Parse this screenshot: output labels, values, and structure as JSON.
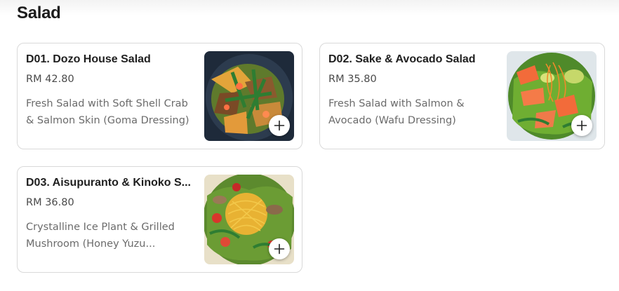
{
  "section": {
    "title": "Salad"
  },
  "items": [
    {
      "name": "D01. Dozo House Salad",
      "price": "RM 42.80",
      "description": "Fresh Salad with Soft Shell Crab & Salmon Skin (Goma Dressing)",
      "photo_icon": "salad-photo",
      "add_icon": "plus-icon"
    },
    {
      "name": "D02. Sake & Avocado Salad",
      "price": "RM 35.80",
      "description": "Fresh Salad with Salmon & Avocado (Wafu Dressing)",
      "photo_icon": "salad-photo",
      "add_icon": "plus-icon"
    },
    {
      "name": "D03. Aisupuranto & Kinoko S...",
      "price": "RM 36.80",
      "description": "Crystalline Ice Plant & Grilled Mushroom (Honey Yuzu...",
      "photo_icon": "salad-photo",
      "add_icon": "plus-icon"
    }
  ]
}
